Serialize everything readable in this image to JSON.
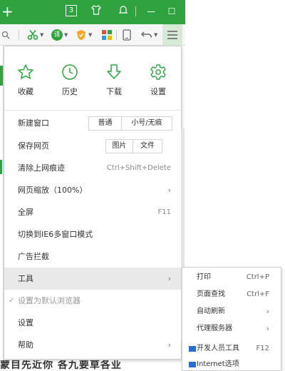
{
  "titlebar": {
    "new_tab": "+",
    "tab_count": "3",
    "shirt_icon": "shirt-icon",
    "minimize": "—",
    "maximize": "☐",
    "close": "✕"
  },
  "toolbar": {
    "search_icon": "magnifier-icon",
    "translate_label": "译",
    "menu_icon": "hamburger-icon"
  },
  "quick_actions": [
    {
      "label": "收藏",
      "icon": "star-icon"
    },
    {
      "label": "历史",
      "icon": "clock-icon"
    },
    {
      "label": "下载",
      "icon": "download-arrow-icon"
    },
    {
      "label": "设置",
      "icon": "gear-icon"
    }
  ],
  "menu": {
    "new_window": {
      "label": "新建窗口",
      "opt1": "普通",
      "opt2": "小号/无痕"
    },
    "save_page": {
      "label": "保存网页",
      "opt1": "图片",
      "opt2": "文件"
    },
    "clear_traces": {
      "label": "清除上网痕迹",
      "shortcut": "Ctrl+Shift+Delete"
    },
    "zoom": {
      "label": "网页缩放（100%）",
      "arrow": "›"
    },
    "fullscreen": {
      "label": "全屏",
      "shortcut": "F11"
    },
    "ie6_mode": {
      "label": "切换到IE6多窗口模式"
    },
    "ad_block": {
      "label": "广告拦截"
    },
    "tools": {
      "label": "工具",
      "arrow": "›"
    },
    "default_browser": {
      "label": "设置为默认浏览器",
      "check": "✓"
    },
    "settings": {
      "label": "设置"
    },
    "help": {
      "label": "帮助",
      "arrow": "›"
    }
  },
  "submenu": {
    "print": {
      "label": "打印",
      "shortcut": "Ctrl+P"
    },
    "find": {
      "label": "页面查找",
      "shortcut": "Ctrl+F"
    },
    "auto_refresh": {
      "label": "自动刷新",
      "arrow": "›"
    },
    "proxy": {
      "label": "代理服务器",
      "arrow": "›"
    },
    "devtools": {
      "label": "开发人员工具",
      "shortcut": "F12"
    },
    "internet_options": {
      "label": "Internet选项"
    }
  },
  "background": {
    "partial_text": "蒙目先近你 各九要草各业"
  },
  "colors": {
    "brand_green": "#2fa340",
    "hover_gray": "#e9e9e9"
  }
}
